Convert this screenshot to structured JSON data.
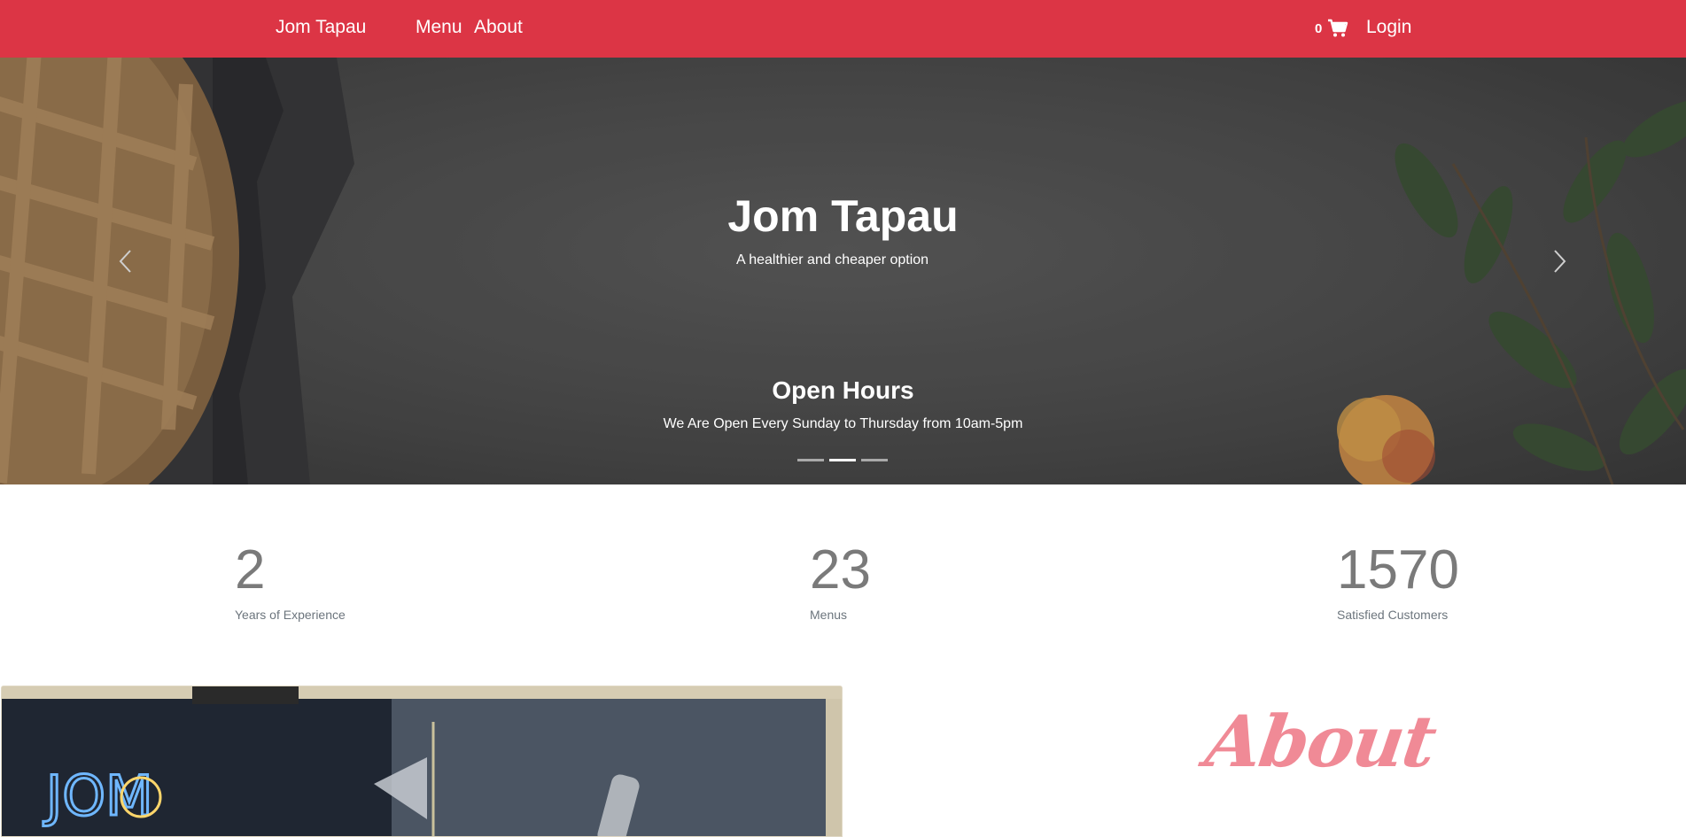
{
  "navbar": {
    "brand": "Jom Tapau",
    "links": [
      "Menu",
      "About"
    ],
    "cart_count": "0",
    "login": "Login",
    "background_color": "#dc3545"
  },
  "hero": {
    "title": "Jom Tapau",
    "subtitle": "A healthier and cheaper option",
    "caption_title": "Open Hours",
    "caption_text": "We Are Open Every Sunday to Thursday from 10am-5pm",
    "slide_count": 3,
    "active_slide": 2
  },
  "stats": [
    {
      "value": "2",
      "label": "Years of Experience"
    },
    {
      "value": "23",
      "label": "Menus"
    },
    {
      "value": "1570",
      "label": "Satisfied Customers"
    }
  ],
  "about": {
    "heading": "About",
    "heading_color": "#f08a96",
    "sign_text": "JOM"
  }
}
